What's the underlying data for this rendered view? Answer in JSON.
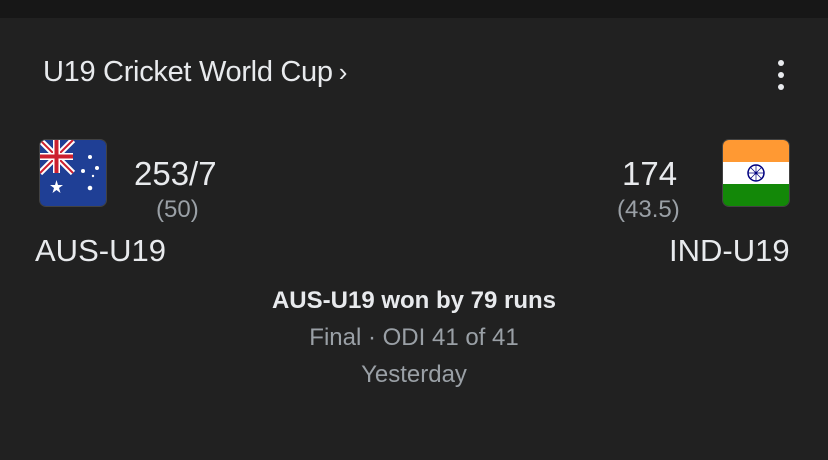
{
  "header": {
    "title": "U19 Cricket World Cup",
    "chevron": "›",
    "more_icon": "more-vert-icon"
  },
  "teams": [
    {
      "name": "AUS-U19",
      "score": "253/7",
      "overs": "(50)",
      "flag_icon": "australia-flag-icon"
    },
    {
      "name": "IND-U19",
      "score": "174",
      "overs": "(43.5)",
      "flag_icon": "india-flag-icon"
    }
  ],
  "match": {
    "result": "AUS-U19 won by 79 runs",
    "status": "Final · ODI 41 of 41",
    "date": "Yesterday"
  },
  "colors": {
    "background": "#212121",
    "text_primary": "#e8eaed",
    "text_secondary": "#9aa0a6"
  }
}
